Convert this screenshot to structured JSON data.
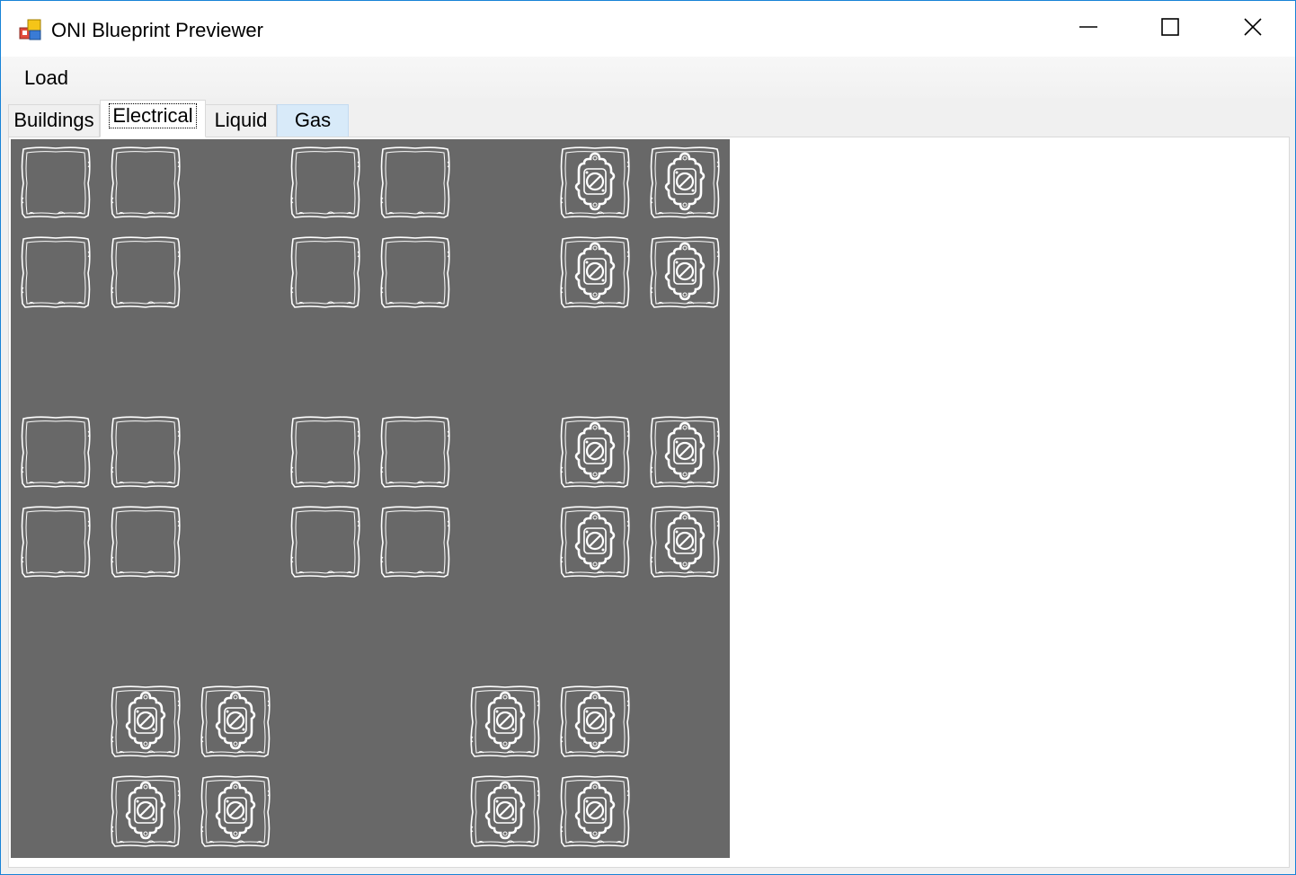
{
  "window": {
    "title": "ONI Blueprint Previewer"
  },
  "menu": {
    "load_label": "Load"
  },
  "tabs": [
    {
      "label": "Buildings",
      "selected": false
    },
    {
      "label": "Electrical",
      "selected": true
    },
    {
      "label": "Liquid",
      "selected": false
    },
    {
      "label": "Gas",
      "selected": false,
      "hovered": true
    }
  ],
  "canvas": {
    "background_color": "#686868",
    "tile_outline_color": "#ffffff",
    "grid_cell_size": 100,
    "empty_tiles": [
      [
        0,
        0
      ],
      [
        1,
        0
      ],
      [
        3,
        0
      ],
      [
        4,
        0
      ],
      [
        0,
        1
      ],
      [
        1,
        1
      ],
      [
        3,
        1
      ],
      [
        4,
        1
      ],
      [
        0,
        3
      ],
      [
        1,
        3
      ],
      [
        3,
        3
      ],
      [
        4,
        3
      ],
      [
        0,
        4
      ],
      [
        1,
        4
      ],
      [
        3,
        4
      ],
      [
        4,
        4
      ]
    ],
    "switch_tiles": [
      [
        6,
        0
      ],
      [
        7,
        0
      ],
      [
        6,
        1
      ],
      [
        7,
        1
      ],
      [
        6,
        3
      ],
      [
        7,
        3
      ],
      [
        6,
        4
      ],
      [
        7,
        4
      ],
      [
        1,
        6
      ],
      [
        2,
        6
      ],
      [
        5,
        6
      ],
      [
        6,
        6
      ],
      [
        1,
        7
      ],
      [
        2,
        7
      ],
      [
        5,
        7
      ],
      [
        6,
        7
      ]
    ]
  },
  "icons": {
    "app": "app-icon",
    "minimize": "minimize-icon",
    "maximize": "maximize-icon",
    "close": "close-icon",
    "empty_tile": "wire-tile-icon",
    "switch_tile": "power-switch-tile-icon"
  }
}
